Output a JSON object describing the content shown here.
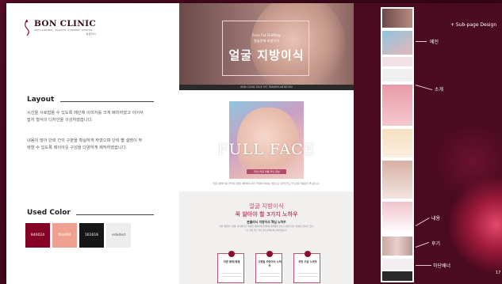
{
  "brand": {
    "name": "BON CLINIC",
    "tagline": "ANTI-AGEING · PLASTIC SURGERY CENTER",
    "tagline_kr": "본클리닉"
  },
  "left": {
    "layout_title": "Layout",
    "layout_para1": "시선을 사로잡을 수 있도록 메인에 이미지를 크게 배치하였고 이어서 잡지 형식의 디자인을 구성하였습니다.",
    "layout_para2": "내용이 많아 단락 간의 구분을 확실하게 하였으며 단락 별 설명이 뚜렷할 수 있도록 레이아웃 구성을 다양하게 제작하였습니다.",
    "color_title": "Used Color",
    "swatches": [
      {
        "hex": "#840024",
        "label": "840024",
        "text_color": "#ffffff"
      },
      {
        "hex": "#f0a090",
        "label": "f0a090",
        "text_color": "#ffffff"
      },
      {
        "hex": "#161616",
        "label": "161616",
        "text_color": "#ffffff"
      },
      {
        "hex": "#ededed",
        "label": "ededed",
        "text_color": "#555555"
      }
    ]
  },
  "preview": {
    "hero_small1": "Face Fat Grafting",
    "hero_small2": "얼굴전체 지방이식",
    "hero_title": "얼굴 지방이식",
    "strip": "BON CLINIC FACE FAT TRANSPLANTATION",
    "ff_title": "FULL FACE",
    "ff_pill": "자연스러운 볼륨 라인 완성",
    "ff_desc": "얼굴 지방이식은 본인의 지방을 채취하여 꺼진 부위에 이식하는 방법으로 자연스럽고 부드러운 볼륨감을 연출합니다.",
    "g_head1": "얼굴 지방이식",
    "g_head2": "꼭 알아야 할 3가지 노하우",
    "g_sub": "본클리닉 지방이식 핵심 노하우",
    "g_body": "지방 채취부터 정제, 이식까지 전 과정을 세심하게 진행하여 생착률을 높이고 자연스러운 결과를 만들어 드립니다. 경험 많은 의료진이 정확하게 디자인합니다.",
    "cards": [
      {
        "label": "지방 채취/정제"
      },
      {
        "label": "고정밀 지방이식 노하우"
      },
      {
        "label": "지방 조공 노하우"
      }
    ]
  },
  "right": {
    "header": "+ Sub-page Design",
    "labels": [
      "메인",
      "소개",
      "내용",
      "후기",
      "하단배너"
    ],
    "page_number": "17"
  }
}
